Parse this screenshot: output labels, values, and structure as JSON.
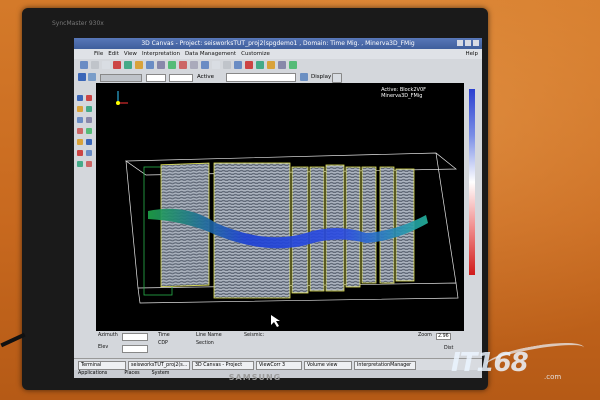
{
  "monitor": {
    "brand_small": "SyncMaster 930x",
    "logo": "SAMSUNG"
  },
  "window": {
    "title": "3D Canvas - Project: seisworksTUT_proj2(spgdemo1 , Domain: Time Mig. , Minerva3D_FMig"
  },
  "menu": {
    "items": [
      "File",
      "Edit",
      "View",
      "Interpretation",
      "Data Management",
      "Customize"
    ],
    "help": "Help"
  },
  "toolbar": {
    "active_label": "Active",
    "display_label": "Display"
  },
  "viewport": {
    "info_line1": "Active: Block2V0F",
    "info_line2": "Minerva3D_FMig"
  },
  "colorbar": {
    "top_color": "#2a3fd0",
    "mid_color": "#ffffff",
    "bottom_color": "#d01a1a"
  },
  "status": {
    "azimuth_label": "Azimuth",
    "elev_label": "Elev",
    "time_label": "Time",
    "line_name_label": "Line Name",
    "seismic_label": "Seismic:",
    "cdp_label": "CDP",
    "section_label": "Section",
    "zoom_label": "Zoom",
    "zoom_value": "2.96",
    "dist_label": "Dist"
  },
  "taskbar": {
    "top_tasks": [
      "Terminal",
      "seisworksTUT_proj2(s...",
      "3D Canvas - Project",
      "ViewCorr 3",
      "Volume view",
      "InterpretationManager"
    ],
    "bottom_items": [
      "Applications",
      "Places",
      "System"
    ]
  },
  "watermark": {
    "text": "IT168",
    "sub": ".com"
  }
}
